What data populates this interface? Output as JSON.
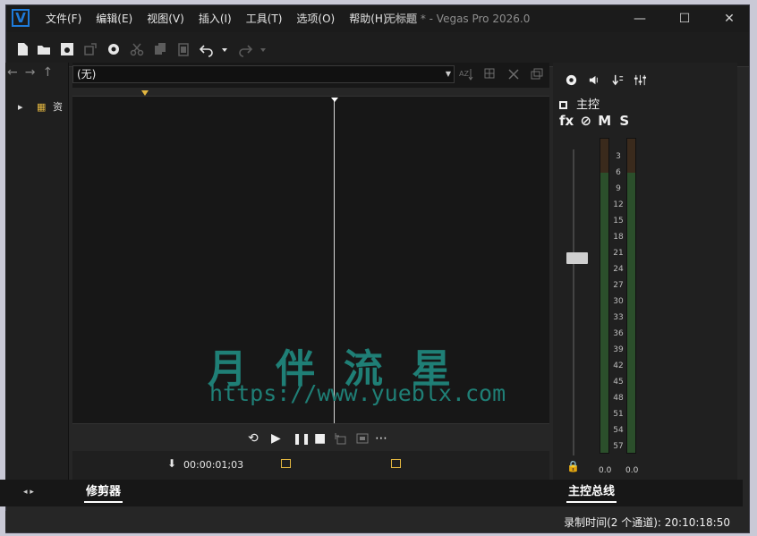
{
  "window": {
    "title_untitled": "无标题",
    "title_rest": " * - Vegas Pro 2026.0",
    "min_glyph": "—",
    "max_glyph": "☐",
    "close_glyph": "✕",
    "logo": "V"
  },
  "menu": [
    "文件(F)",
    "编辑(E)",
    "视图(V)",
    "插入(I)",
    "工具(T)",
    "选项(O)",
    "帮助(H)"
  ],
  "toolbar_icons": [
    "new-file-icon",
    "open-folder-icon",
    "save-icon",
    "render-icon",
    "settings-icon",
    "cut-icon",
    "copy-icon",
    "paste-icon",
    "undo-icon",
    "redo-icon"
  ],
  "left_panel": {
    "nav": [
      "←",
      "→",
      "↑"
    ],
    "tree_expander": "▸",
    "tree_folder": "▦",
    "tree_item": "资"
  },
  "trimmer": {
    "dropdown_value": "(无)",
    "dropdown_arrow": "▼",
    "timecode": "00:00:01;03",
    "pin_glyph": "⬇",
    "transport": {
      "loop": "⟲",
      "play": "▶",
      "pause": "❚❚",
      "stop": "■",
      "more": "⋯"
    }
  },
  "tabs": {
    "trimmer_label": "修剪器",
    "master_label": "主控总线",
    "left_nav": "◂ ▸"
  },
  "master": {
    "label": "主控",
    "fx": "fx",
    "link": "⊘",
    "mute": "M",
    "solo": "S",
    "meter_left_value": "0.0",
    "meter_right_value": "0.0",
    "lock_glyph": "🔒",
    "scale": [
      "3",
      "6",
      "9",
      "12",
      "15",
      "18",
      "21",
      "24",
      "27",
      "30",
      "33",
      "36",
      "39",
      "42",
      "45",
      "48",
      "51",
      "54",
      "57"
    ],
    "icons": [
      "gear-icon",
      "speaker-icon",
      "down-arrow-icon",
      "mixer-icon"
    ]
  },
  "statusbar": {
    "record_info": "录制时间(2 个通道): 20:10:18:50"
  },
  "watermark": {
    "text": "月伴流星",
    "url": "https://www.yueblx.com"
  },
  "colors": {
    "accent": "#1e7ad9",
    "marker": "#e2b640",
    "watermark": "#1f7f76"
  }
}
